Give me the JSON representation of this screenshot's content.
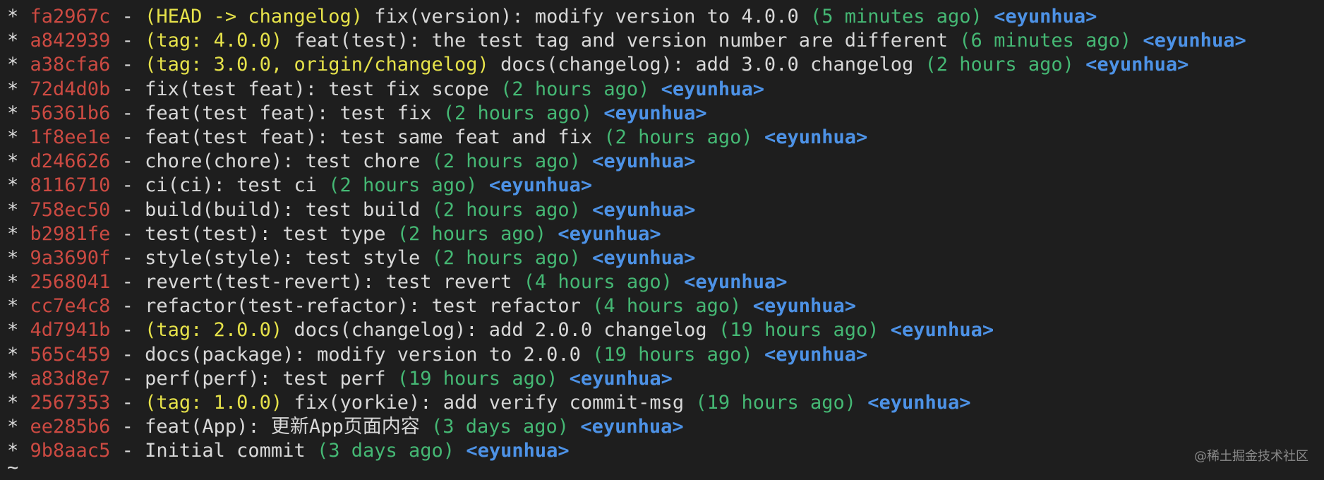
{
  "commits": [
    {
      "hash": "fa2967c",
      "refs": "(HEAD -> changelog)",
      "message": "fix(version): modify version to 4.0.0",
      "date": "(5 minutes ago)",
      "author": "<eyunhua>"
    },
    {
      "hash": "a842939",
      "refs": "(tag: 4.0.0)",
      "message": "feat(test): the test tag and version number are different",
      "date": "(6 minutes ago)",
      "author": "<eyunhua>"
    },
    {
      "hash": "a38cfa6",
      "refs": "(tag: 3.0.0, origin/changelog)",
      "message": "docs(changelog): add 3.0.0 changelog",
      "date": "(2 hours ago)",
      "author": "<eyunhua>"
    },
    {
      "hash": "72d4d0b",
      "refs": "",
      "message": "fix(test feat): test fix scope",
      "date": "(2 hours ago)",
      "author": "<eyunhua>"
    },
    {
      "hash": "56361b6",
      "refs": "",
      "message": "feat(test feat): test fix",
      "date": "(2 hours ago)",
      "author": "<eyunhua>"
    },
    {
      "hash": "1f8ee1e",
      "refs": "",
      "message": "feat(test feat): test same feat and fix",
      "date": "(2 hours ago)",
      "author": "<eyunhua>"
    },
    {
      "hash": "d246626",
      "refs": "",
      "message": "chore(chore): test chore",
      "date": "(2 hours ago)",
      "author": "<eyunhua>"
    },
    {
      "hash": "8116710",
      "refs": "",
      "message": "ci(ci): test ci",
      "date": "(2 hours ago)",
      "author": "<eyunhua>"
    },
    {
      "hash": "758ec50",
      "refs": "",
      "message": "build(build): test build",
      "date": "(2 hours ago)",
      "author": "<eyunhua>"
    },
    {
      "hash": "b2981fe",
      "refs": "",
      "message": "test(test): test type",
      "date": "(2 hours ago)",
      "author": "<eyunhua>"
    },
    {
      "hash": "9a3690f",
      "refs": "",
      "message": "style(style): test style",
      "date": "(2 hours ago)",
      "author": "<eyunhua>"
    },
    {
      "hash": "2568041",
      "refs": "",
      "message": "revert(test-revert): test revert",
      "date": "(4 hours ago)",
      "author": "<eyunhua>"
    },
    {
      "hash": "cc7e4c8",
      "refs": "",
      "message": "refactor(test-refactor): test refactor",
      "date": "(4 hours ago)",
      "author": "<eyunhua>"
    },
    {
      "hash": "4d7941b",
      "refs": "(tag: 2.0.0)",
      "message": "docs(changelog): add 2.0.0 changelog",
      "date": "(19 hours ago)",
      "author": "<eyunhua>"
    },
    {
      "hash": "565c459",
      "refs": "",
      "message": "docs(package): modify version to 2.0.0",
      "date": "(19 hours ago)",
      "author": "<eyunhua>"
    },
    {
      "hash": "a83d8e7",
      "refs": "",
      "message": "perf(perf): test perf",
      "date": "(19 hours ago)",
      "author": "<eyunhua>"
    },
    {
      "hash": "2567353",
      "refs": "(tag: 1.0.0)",
      "message": "fix(yorkie): add verify commit-msg",
      "date": "(19 hours ago)",
      "author": "<eyunhua>"
    },
    {
      "hash": "ee285b6",
      "refs": "",
      "message": "feat(App): 更新App页面内容",
      "date": "(3 days ago)",
      "author": "<eyunhua>"
    },
    {
      "hash": "9b8aac5",
      "refs": "",
      "message": "Initial commit",
      "date": "(3 days ago)",
      "author": "<eyunhua>"
    }
  ],
  "graph_marker": "*",
  "separator": "-",
  "prompt": "~",
  "watermark": "@稀土掘金技术社区"
}
